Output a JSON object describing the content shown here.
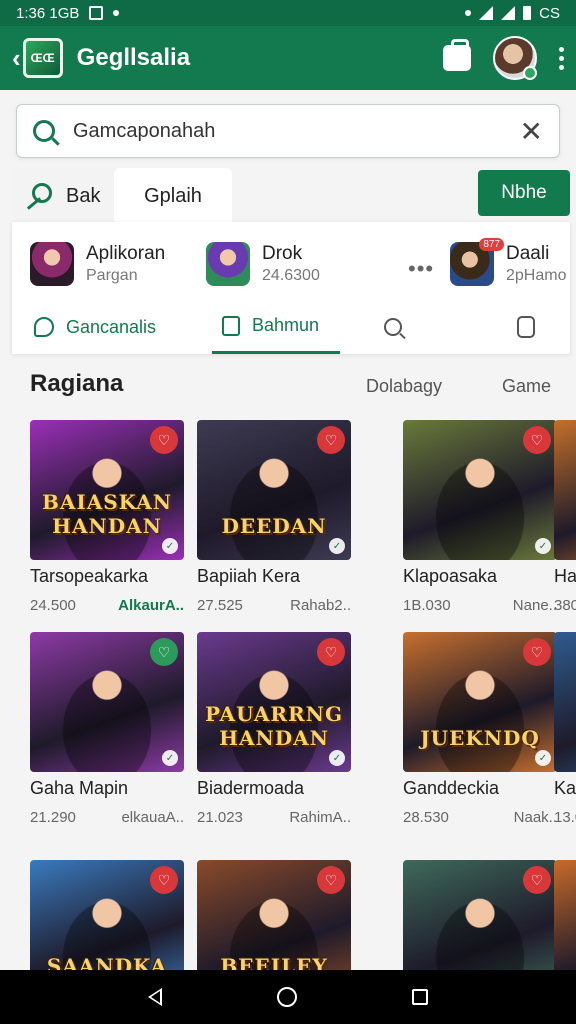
{
  "status_bar": {
    "time": "1:36 1GB",
    "battery_text": "CS"
  },
  "app_bar": {
    "logo_text": "ŒŒ",
    "title": "Gegllsalia"
  },
  "search": {
    "value": "Gamcaponahah"
  },
  "tab_strip": {
    "tab1_label": "Bak",
    "tab2_label": "Gplaih",
    "button_label": "Nbhe"
  },
  "featured_apps": [
    {
      "title": "Aplikoran",
      "subtitle": "Pargan"
    },
    {
      "title": "Drok",
      "subtitle": "24.6300"
    },
    {
      "title": "Daali",
      "subtitle": "2pHamo",
      "badge": "877"
    }
  ],
  "nav_tabs": [
    {
      "label": "Gancanalis"
    },
    {
      "label": "Bahmun"
    }
  ],
  "section": {
    "title": "Ragiana",
    "link1": "Dolabagy",
    "link2": "Game"
  },
  "games": [
    {
      "title": "Tarsopeakarka",
      "size": "24.500",
      "publisher": "AlkaurA..",
      "art_text": "BAIASKAN HANDAN",
      "accent": "#9b2fb8"
    },
    {
      "title": "Bapiiah Kera",
      "size": "27.525",
      "publisher": "Rahab2..",
      "art_text": "DEEDAN",
      "accent": "#3e3a52"
    },
    {
      "title": "Klapoasaka",
      "size": "1B.030",
      "publisher": "Nane..",
      "art_text": "",
      "accent": "#6a7a3a"
    },
    {
      "title": "Ha",
      "size": "380",
      "publisher": "",
      "art_text": "",
      "accent": "#c4702a"
    },
    {
      "title": "Gaha Mapin",
      "size": "21.290",
      "publisher": "elkauaA..",
      "art_text": "",
      "accent": "#8e3aa6"
    },
    {
      "title": "Biadermoada",
      "size": "21.023",
      "publisher": "RahimA..",
      "art_text": "PAUARRNG HANDAN",
      "accent": "#6a3a8e"
    },
    {
      "title": "Ganddeckia",
      "size": "28.530",
      "publisher": "Naak..",
      "art_text": "JUEKNDQ",
      "accent": "#c8702e"
    },
    {
      "title": "Ka",
      "size": "13.0",
      "publisher": "",
      "art_text": "",
      "accent": "#2e5c8e"
    },
    {
      "title": "",
      "size": "",
      "publisher": "",
      "art_text": "SAANDKA",
      "accent": "#3a7abf"
    },
    {
      "title": "",
      "size": "",
      "publisher": "",
      "art_text": "BEEILEY",
      "accent": "#8a4a2a"
    },
    {
      "title": "",
      "size": "",
      "publisher": "",
      "art_text": "",
      "accent": "#3e6a5a"
    },
    {
      "title": "",
      "size": "",
      "publisher": "",
      "art_text": "",
      "accent": "#c86a2a"
    }
  ],
  "colors": {
    "brand": "#127a4e",
    "badge_red": "#d8383a"
  }
}
